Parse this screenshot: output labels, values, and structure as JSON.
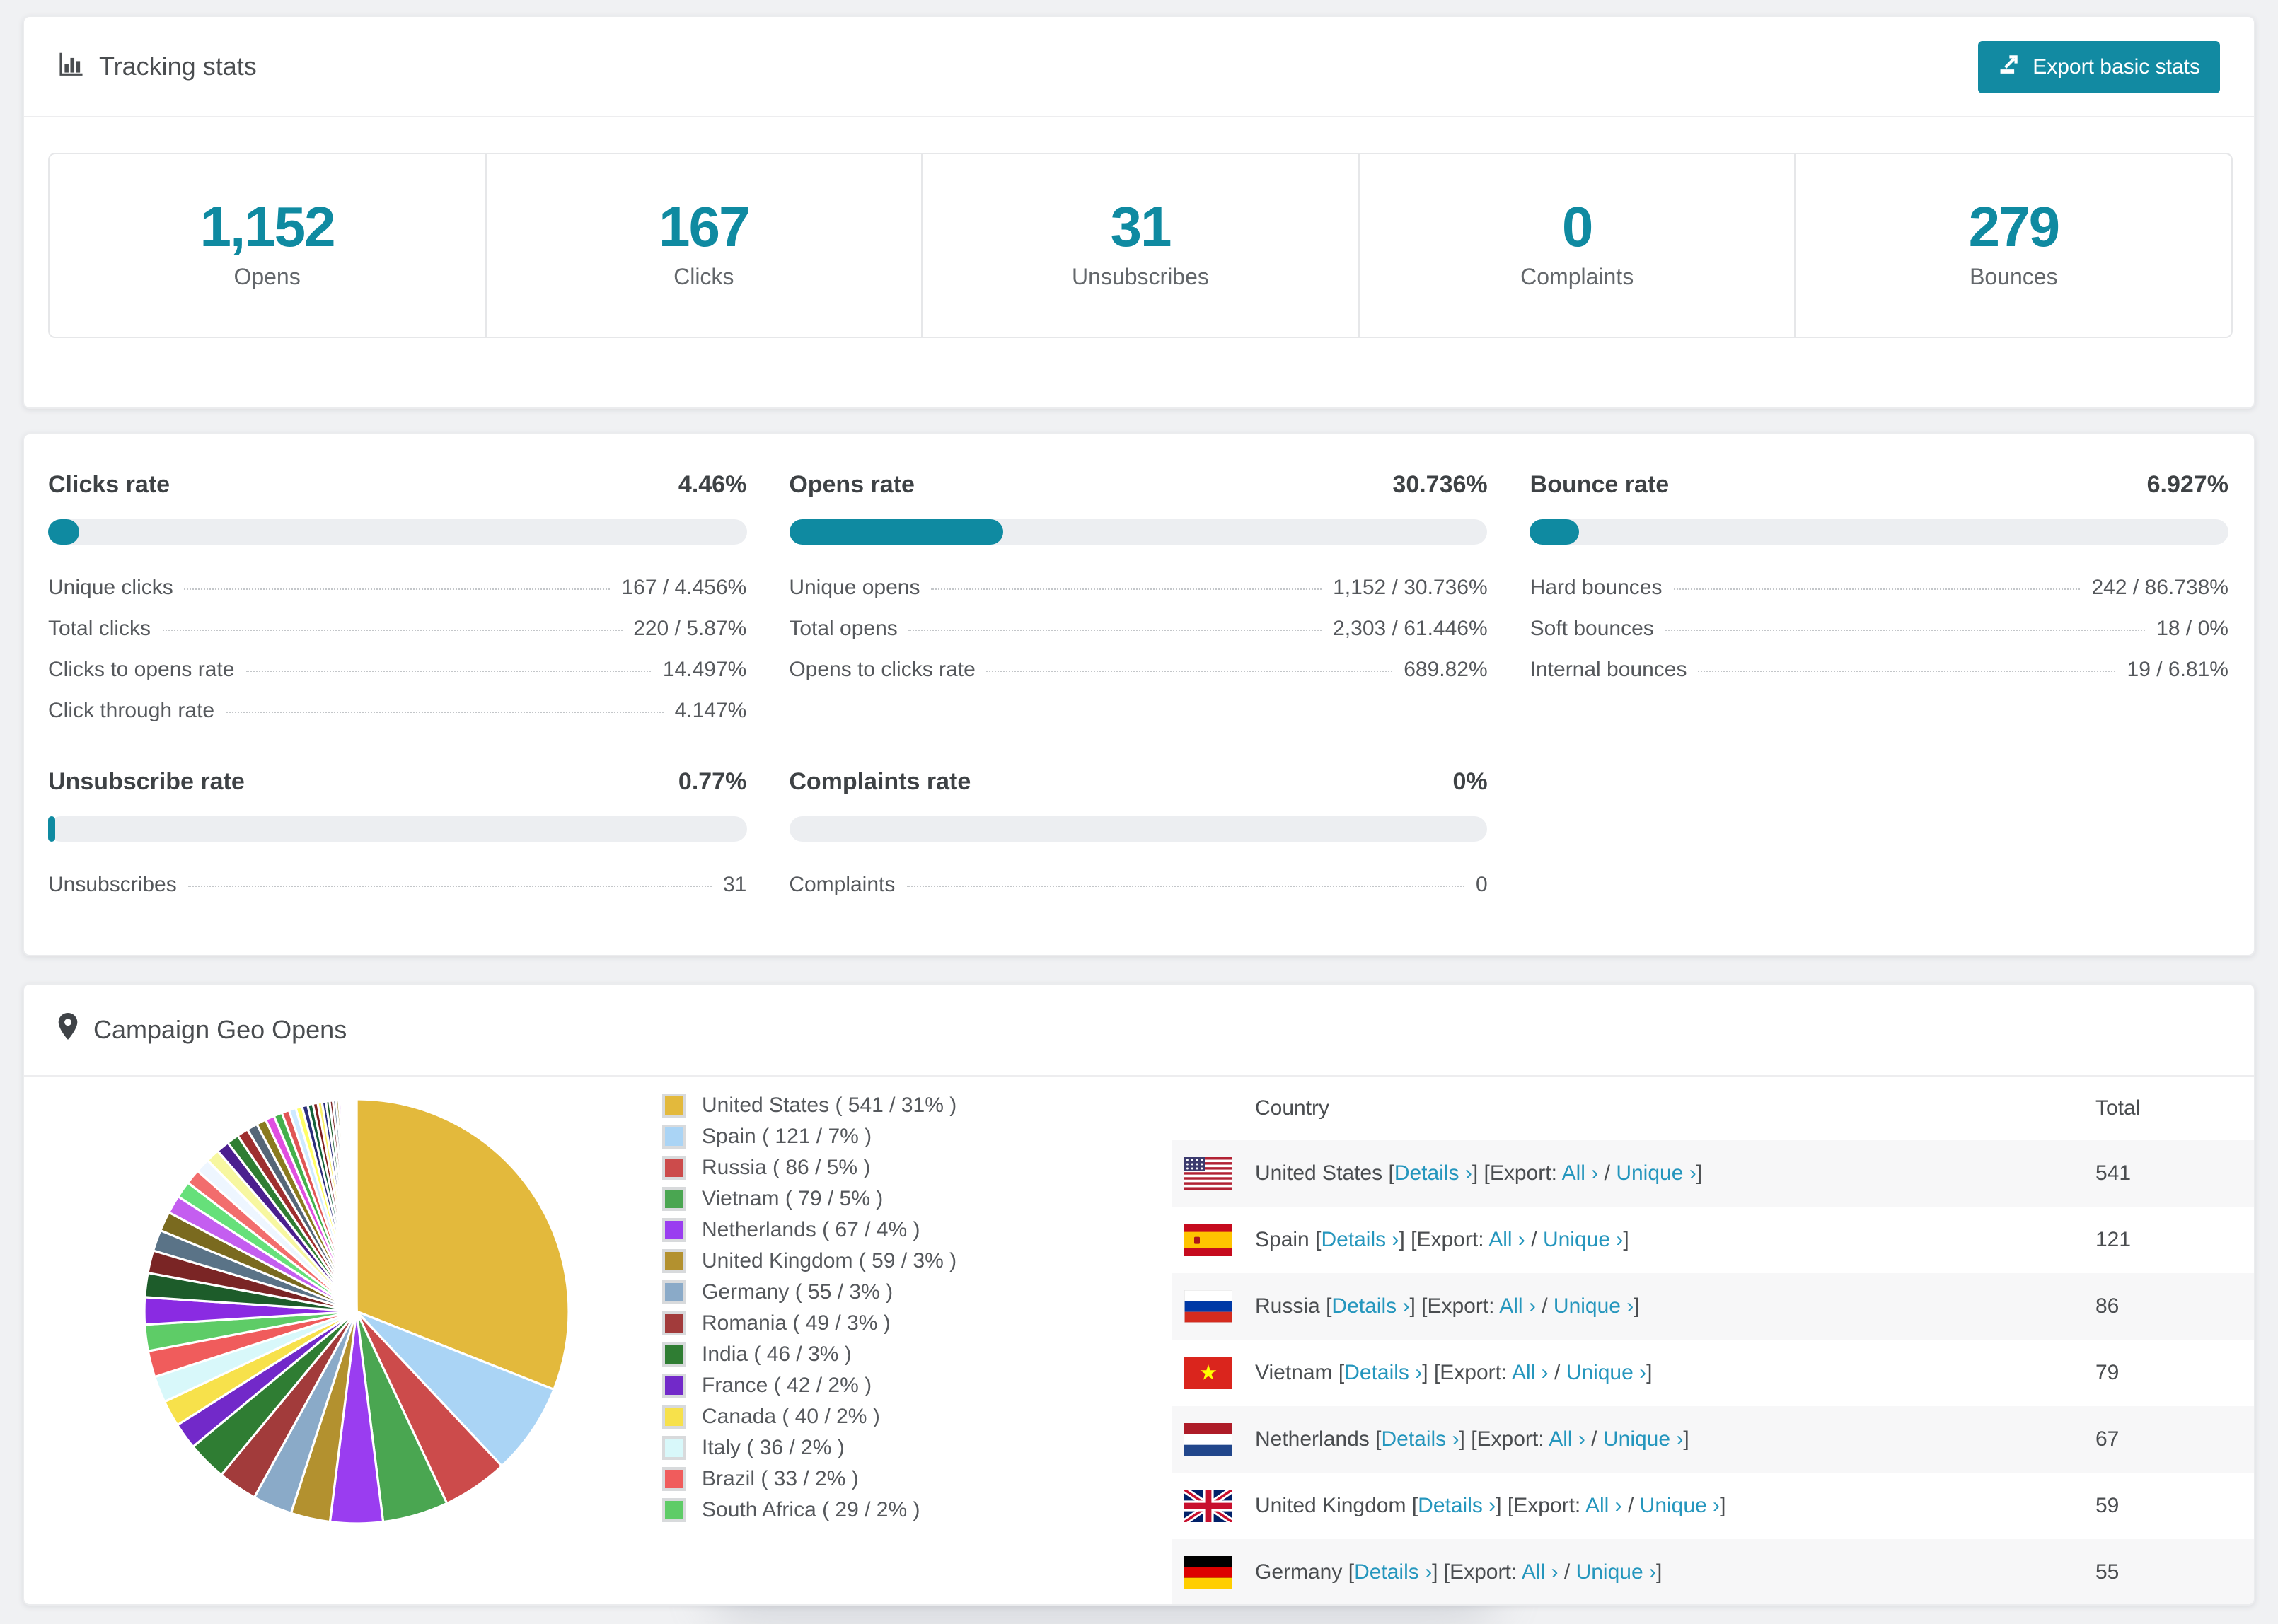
{
  "colors": {
    "accent": "#0f8aa1",
    "link": "#2596bd",
    "page_bg": "#f0f1f3",
    "bar_track": "#eceef1",
    "row_stripe": "#f7f7f8"
  },
  "icons": {
    "tracking_panel": "bar-chart-icon",
    "geo_panel": "map-pin-icon",
    "export_button": "export-arrow-icon"
  },
  "tracking_panel": {
    "title": "Tracking stats",
    "export_button": "Export basic stats",
    "stats": [
      {
        "value": "1,152",
        "label": "Opens"
      },
      {
        "value": "167",
        "label": "Clicks"
      },
      {
        "value": "31",
        "label": "Unsubscribes"
      },
      {
        "value": "0",
        "label": "Complaints"
      },
      {
        "value": "279",
        "label": "Bounces"
      }
    ]
  },
  "rates_panel": {
    "cards": [
      {
        "title": "Clicks rate",
        "value": "4.46%",
        "bar_pct": 4.46,
        "rows": [
          {
            "label": "Unique clicks",
            "value": "167 / 4.456%"
          },
          {
            "label": "Total clicks",
            "value": "220 / 5.87%"
          },
          {
            "label": "Clicks to opens rate",
            "value": "14.497%"
          },
          {
            "label": "Click through rate",
            "value": "4.147%"
          }
        ]
      },
      {
        "title": "Opens rate",
        "value": "30.736%",
        "bar_pct": 30.736,
        "rows": [
          {
            "label": "Unique opens",
            "value": "1,152 / 30.736%"
          },
          {
            "label": "Total opens",
            "value": "2,303 / 61.446%"
          },
          {
            "label": "Opens to clicks rate",
            "value": "689.82%"
          }
        ]
      },
      {
        "title": "Bounce rate",
        "value": "6.927%",
        "bar_pct": 6.927,
        "rows": [
          {
            "label": "Hard bounces",
            "value": "242 / 86.738%"
          },
          {
            "label": "Soft bounces",
            "value": "18 / 0%"
          },
          {
            "label": "Internal bounces",
            "value": "19 / 6.81%"
          }
        ]
      },
      {
        "title": "Unsubscribe rate",
        "value": "0.77%",
        "bar_pct": 0.77,
        "rows": [
          {
            "label": "Unsubscribes",
            "value": "31"
          }
        ]
      },
      {
        "title": "Complaints rate",
        "value": "0%",
        "bar_pct": 0,
        "rows": [
          {
            "label": "Complaints",
            "value": "0"
          }
        ]
      }
    ]
  },
  "geo_panel": {
    "title": "Campaign Geo Opens",
    "table": {
      "headers": [
        "Country",
        "Total"
      ],
      "details_label": "Details",
      "export_label": "Export:",
      "all_label": "All",
      "unique_label": "Unique",
      "arrow": "›",
      "rows": [
        {
          "flag": "us",
          "country": "United States",
          "total": "541"
        },
        {
          "flag": "es",
          "country": "Spain",
          "total": "121"
        },
        {
          "flag": "ru",
          "country": "Russia",
          "total": "86"
        },
        {
          "flag": "vn",
          "country": "Vietnam",
          "total": "79"
        },
        {
          "flag": "nl",
          "country": "Netherlands",
          "total": "67"
        },
        {
          "flag": "gb",
          "country": "United Kingdom",
          "total": "59"
        },
        {
          "flag": "de",
          "country": "Germany",
          "total": "55",
          "partial": true
        }
      ]
    }
  },
  "chart_data": {
    "type": "pie",
    "title": "Campaign Geo Opens",
    "unit": "opens",
    "start_angle_deg": 0,
    "direction": "clockwise",
    "series": [
      {
        "name": "United States",
        "value": 541,
        "pct": 31,
        "color": "#e3b93c"
      },
      {
        "name": "Spain",
        "value": 121,
        "pct": 7,
        "color": "#aad4f5"
      },
      {
        "name": "Russia",
        "value": 86,
        "pct": 5,
        "color": "#cc4b4b"
      },
      {
        "name": "Vietnam",
        "value": 79,
        "pct": 5,
        "color": "#4aa651"
      },
      {
        "name": "Netherlands",
        "value": 67,
        "pct": 4,
        "color": "#9a3df0"
      },
      {
        "name": "United Kingdom",
        "value": 59,
        "pct": 3,
        "color": "#b3912f"
      },
      {
        "name": "Germany",
        "value": 55,
        "pct": 3,
        "color": "#8aaac8"
      },
      {
        "name": "Romania",
        "value": 49,
        "pct": 3,
        "color": "#a23b3b"
      },
      {
        "name": "India",
        "value": 46,
        "pct": 3,
        "color": "#2f7d33"
      },
      {
        "name": "France",
        "value": 42,
        "pct": 2,
        "color": "#7229c9"
      },
      {
        "name": "Canada",
        "value": 40,
        "pct": 2,
        "color": "#f7e14b"
      },
      {
        "name": "Italy",
        "value": 36,
        "pct": 2,
        "color": "#d8f8fa"
      },
      {
        "name": "Brazil",
        "value": 33,
        "pct": 2,
        "color": "#f05c5c"
      },
      {
        "name": "South Africa",
        "value": 29,
        "pct": 2,
        "color": "#5ecc67"
      }
    ],
    "unlabeled_tail": {
      "total_pct": 26,
      "slices": [
        {
          "pct": 1.8,
          "color": "#8a2be2"
        },
        {
          "pct": 1.6,
          "color": "#1d5c2a"
        },
        {
          "pct": 1.5,
          "color": "#7a2525"
        },
        {
          "pct": 1.4,
          "color": "#5a7387"
        },
        {
          "pct": 1.3,
          "color": "#7a6a1f"
        },
        {
          "pct": 1.2,
          "color": "#c45ef0"
        },
        {
          "pct": 1.1,
          "color": "#66e07a"
        },
        {
          "pct": 1.0,
          "color": "#f26d6d"
        },
        {
          "pct": 0.95,
          "color": "#eef6ff"
        },
        {
          "pct": 0.9,
          "color": "#f7f7a0"
        },
        {
          "pct": 0.85,
          "color": "#4b1f8e"
        },
        {
          "pct": 0.8,
          "color": "#2f7d33"
        },
        {
          "pct": 0.75,
          "color": "#9e2f2f"
        },
        {
          "pct": 0.7,
          "color": "#556677"
        },
        {
          "pct": 0.65,
          "color": "#8a7a1f"
        },
        {
          "pct": 0.6,
          "color": "#e04fe0"
        },
        {
          "pct": 0.55,
          "color": "#44b04c"
        },
        {
          "pct": 0.5,
          "color": "#e05555"
        },
        {
          "pct": 0.46,
          "color": "#cfeaff"
        },
        {
          "pct": 0.42,
          "color": "#ffff66"
        },
        {
          "pct": 0.38,
          "color": "#2b2e7a"
        },
        {
          "pct": 0.35,
          "color": "#15603a"
        },
        {
          "pct": 0.32,
          "color": "#801f1f"
        },
        {
          "pct": 0.29,
          "color": "#faf06a"
        },
        {
          "pct": 0.26,
          "color": "#2b2e7a"
        },
        {
          "pct": 0.24,
          "color": "#1d5c2a"
        },
        {
          "pct": 0.22,
          "color": "#7a2525"
        },
        {
          "pct": 0.2,
          "color": "#5a7387"
        },
        {
          "pct": 0.18,
          "color": "#8a7a1f"
        },
        {
          "pct": 0.16,
          "color": "#c45ef0"
        },
        {
          "pct": 0.14,
          "color": "#66e07a"
        },
        {
          "pct": 0.12,
          "color": "#f26d6d"
        },
        {
          "pct": 0.11,
          "color": "#63d66e"
        },
        {
          "pct": 0.1,
          "color": "#e3b93c"
        },
        {
          "pct": 0.09,
          "color": "#a8d4f0"
        },
        {
          "pct": 0.08,
          "color": "#d84343"
        },
        {
          "pct": 0.07,
          "color": "#3d9e47"
        },
        {
          "pct": 0.06,
          "color": "#8833dd"
        },
        {
          "pct": 0.05,
          "color": "#b3912f"
        },
        {
          "pct": 0.05,
          "color": "#cc4b4b"
        },
        {
          "pct": 0.04,
          "color": "#aad4f5"
        },
        {
          "pct": 0.04,
          "color": "#e04fe0"
        },
        {
          "pct": 0.03,
          "color": "#7229c9"
        },
        {
          "pct": 0.03,
          "color": "#63d66e"
        }
      ]
    }
  }
}
